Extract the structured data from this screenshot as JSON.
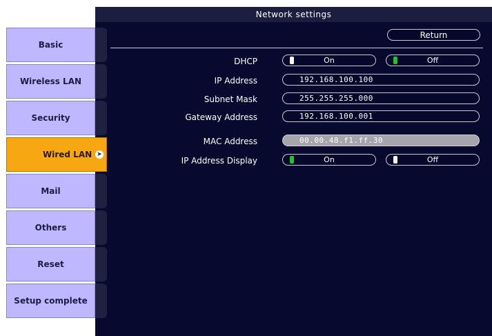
{
  "title": "Network settings",
  "return_label": "Return",
  "sidebar": {
    "items": [
      {
        "label": "Basic"
      },
      {
        "label": "Wireless LAN"
      },
      {
        "label": "Security"
      },
      {
        "label": "Wired LAN",
        "active": true
      },
      {
        "label": "Mail"
      },
      {
        "label": "Others"
      },
      {
        "label": "Reset"
      },
      {
        "label": "Setup complete"
      }
    ]
  },
  "settings": {
    "dhcp": {
      "label": "DHCP",
      "on_label": "On",
      "off_label": "Off",
      "selected": "Off"
    },
    "ip_address": {
      "label": "IP Address",
      "value": "192.168.100.100"
    },
    "subnet_mask": {
      "label": "Subnet Mask",
      "value": "255.255.255.000"
    },
    "gateway_address": {
      "label": "Gateway Address",
      "value": "192.168.100.001"
    },
    "mac_address": {
      "label": "MAC Address",
      "value": "00.00.48.f1.ff.30"
    },
    "ip_address_display": {
      "label": "IP Address Display",
      "on_label": "On",
      "off_label": "Off",
      "selected": "On"
    }
  },
  "colors": {
    "screen_bg": "#070a2e",
    "sidebar_item": "#bfb7ff",
    "sidebar_active": "#f7a711",
    "indicator_on": "#22c22c"
  },
  "icons": {
    "active_marker": "arrow-right-circle-icon"
  }
}
